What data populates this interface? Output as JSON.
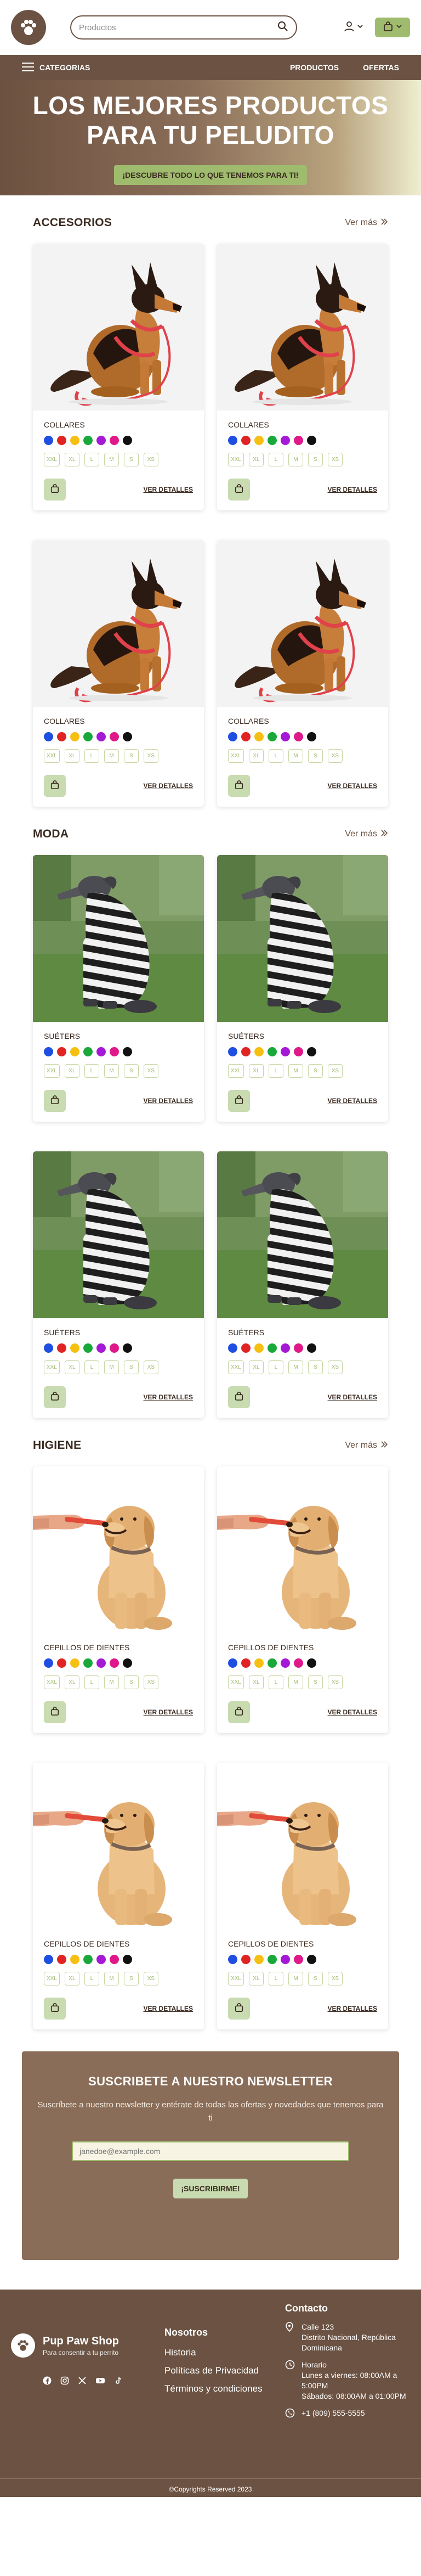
{
  "header": {
    "search_placeholder": "Productos",
    "icons": {
      "logo": "paw-icon",
      "search": "search-icon",
      "user": "user-icon",
      "cart": "shopping-bag-icon"
    }
  },
  "nav": {
    "categories_label": "CATEGORIAS",
    "links": [
      "PRODUCTOS",
      "OFERTAS"
    ]
  },
  "hero": {
    "title_line1": "LOS MEJORES PRODUCTOS",
    "title_line2": "PARA TU PELUDITO",
    "cta": "¡DESCUBRE TODO LO QUE TENEMOS PARA TI!"
  },
  "colors": {
    "brand_brown": "#6b5242",
    "accent_green": "#9fbb6e",
    "swatches": [
      "#1f4fe0",
      "#e02424",
      "#f6c012",
      "#19a83a",
      "#a419d6",
      "#e0198a",
      "#111111"
    ]
  },
  "sizes": [
    "XXL",
    "XL",
    "L",
    "M",
    "S",
    "XS"
  ],
  "sections": [
    {
      "title": "ACCESORIOS",
      "more": "Ver más",
      "products": [
        {
          "name": "COLLARES",
          "details": "VER DETALLES"
        },
        {
          "name": "COLLARES",
          "details": "VER DETALLES"
        },
        {
          "name": "COLLARES",
          "details": "VER DETALLES"
        },
        {
          "name": "COLLARES",
          "details": "VER DETALLES"
        }
      ]
    },
    {
      "title": "MODA",
      "more": "Ver más",
      "products": [
        {
          "name": "SUÉTERS",
          "details": "VER DETALLES"
        },
        {
          "name": "SUÉTERS",
          "details": "VER DETALLES"
        },
        {
          "name": "SUÉTERS",
          "details": "VER DETALLES"
        },
        {
          "name": "SUÉTERS",
          "details": "VER DETALLES"
        }
      ]
    },
    {
      "title": "HIGIENE",
      "more": "Ver más",
      "products": [
        {
          "name": "CEPILLOS DE DIENTES",
          "details": "VER DETALLES"
        },
        {
          "name": "CEPILLOS DE DIENTES",
          "details": "VER DETALLES"
        },
        {
          "name": "CEPILLOS DE DIENTES",
          "details": "VER DETALLES"
        },
        {
          "name": "CEPILLOS DE DIENTES",
          "details": "VER DETALLES"
        }
      ]
    }
  ],
  "newsletter": {
    "title": "SUSCRIBETE A NUESTRO NEWSLETTER",
    "text": "Suscríbete a nuestro newsletter y entérate de todas las ofertas y novedades que tenemos para ti",
    "placeholder": "janedoe@example.com",
    "button": "¡SUSCRIBIRME!"
  },
  "footer": {
    "brand": "Pup Paw Shop",
    "tagline": "Para consentir a tu perrito",
    "nav_title": "Nosotros",
    "nav_links": [
      "Historia",
      "Políticas de Privacidad",
      "Términos y condiciones"
    ],
    "contact_title": "Contacto",
    "address": "Calle 123\nDistrito Nacional, República Dominicana",
    "hours": "Horario\nLunes a viernes: 08:00AM a 5:00PM\nSábados: 08:00AM a 01:00PM",
    "phone": "+1 (809) 555-5555",
    "copyright": "©Copyrights Reserved 2023",
    "social_icons": [
      "facebook-icon",
      "instagram-icon",
      "x-icon",
      "youtube-icon",
      "tiktok-icon"
    ]
  }
}
